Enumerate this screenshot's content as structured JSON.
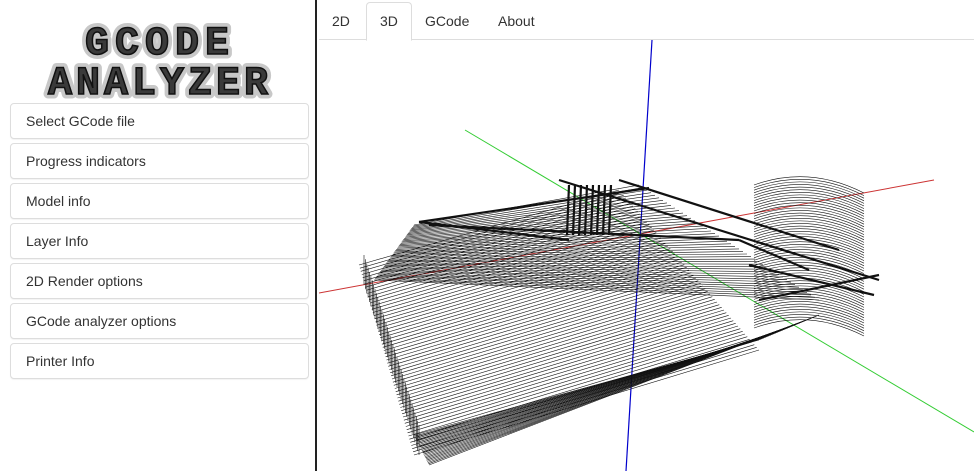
{
  "logo": {
    "line1": "GCODE",
    "line2": "ANALYZER"
  },
  "sidebar": {
    "items": [
      {
        "label": "Select GCode file"
      },
      {
        "label": "Progress indicators"
      },
      {
        "label": "Model info"
      },
      {
        "label": "Layer Info"
      },
      {
        "label": "2D Render options"
      },
      {
        "label": "GCode analyzer options"
      },
      {
        "label": "Printer Info"
      }
    ]
  },
  "tabs": [
    {
      "label": "2D"
    },
    {
      "label": "3D",
      "active": true
    },
    {
      "label": "GCode"
    },
    {
      "label": "About"
    }
  ],
  "viewport": {
    "axis_colors": {
      "x": "#cc3333",
      "y": "#33cc33",
      "z": "#0000cc"
    },
    "model_color": "#111111"
  }
}
